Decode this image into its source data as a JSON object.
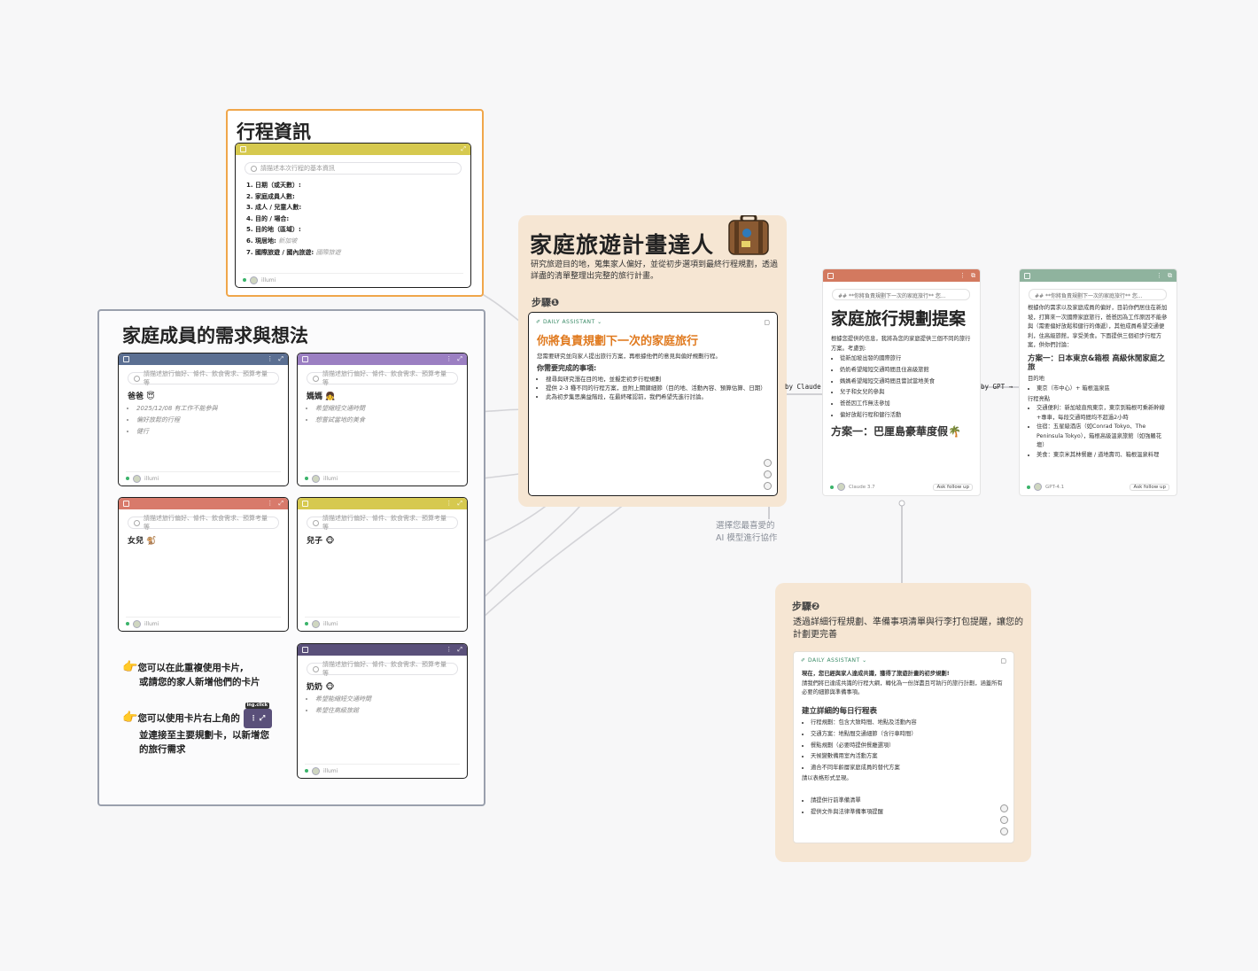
{
  "trip_info": {
    "title": "行程資訊",
    "prompt": "請描述本次行程的基本資訊",
    "items": [
      {
        "label": "1. 日期（或天數）:",
        "value": ""
      },
      {
        "label": "2. 家庭成員人數:",
        "value": ""
      },
      {
        "label": "3. 成人 / 兒童人數:",
        "value": ""
      },
      {
        "label": "4. 目的 / 場合:",
        "value": ""
      },
      {
        "label": "5. 目的地（區域）:",
        "value": ""
      },
      {
        "label": "6. 現居地:",
        "value": "新加坡"
      },
      {
        "label": "7. 國際旅遊 / 國內旅遊:",
        "value": "國際旅遊"
      }
    ],
    "footer_user": "illumi",
    "header_color": "#d6c94f"
  },
  "family": {
    "title": "家庭成員的需求與想法",
    "prompt": "請描述旅行偏好、條件、飲食需求、預算考量等",
    "footer_user": "illumi",
    "members": [
      {
        "name": "爸爸 😇",
        "color": "#5b6f92",
        "bullets": [
          "2025/12/08 有工作不能參與",
          "偏好放鬆的行程",
          "健行"
        ]
      },
      {
        "name": "媽媽 👧",
        "color": "#9b7fc2",
        "bullets": [
          "希望縮短交通時間",
          "想嘗試當地的美食"
        ]
      },
      {
        "name": "女兒 🐒",
        "color": "#d87a6b",
        "bullets": []
      },
      {
        "name": "兒子 🐵",
        "color": "#d6c94f",
        "bullets": []
      },
      {
        "name": "奶奶 🐵",
        "color": "#5a507a",
        "bullets": [
          "希望能縮短交通時間",
          "希望住高級旅館"
        ]
      }
    ]
  },
  "hints": {
    "line1a": "您可以在此重複使用卡片,",
    "line1b": "或請您的家人新增他們的卡片",
    "line2a": "您可以使用卡片右上角的",
    "line2b": "並連接至主要規劃卡，以新增您",
    "line2c": "的旅行需求",
    "hint_badge": "ing.click"
  },
  "planner": {
    "title": "家庭旅遊計畫達人",
    "subtitle": "研究旅遊目的地，蒐集家人偏好，並從初步選項到最終行程規劃，透過詳盡的清單整理出完整的旅行計畫。",
    "step1_label": "步驟❶",
    "assistant_label": "DAILY ASSISTANT",
    "card_title": "你將負責規劃下一次的家庭旅行",
    "card_intro": "您需要研究並向家人提出旅行方案，再根據他們的意見與偏好規劃行程。",
    "todo_heading": "你需要完成的事項:",
    "todos": [
      "搜尋與研究潛在目的地，並擬定初步行程規劃",
      "提供 2-3 種不同的行程方案，並附上關鍵細節（目的地、活動內容、預算估算、日期）",
      "此為初步集思廣益階段，在最終確認前，我們希望先進行討論。"
    ],
    "caption": "選擇您最喜愛的\nAI 模型進行協作"
  },
  "claude_card": {
    "chip": "## **你將負責規劃下一次的家庭旅行** 您...",
    "title": "家庭旅行規劃提案",
    "intro": "根據您提供的信息，我將為您的家庭提供三個不同的旅行方案。考慮到:",
    "points": [
      "從新加坡出發的國際旅行",
      "奶奶希望縮短交通時間且住高級旅館",
      "媽媽希望縮短交通時間且嘗試當地美食",
      "兒子和女兒的參與",
      "爸爸因工作無法參加",
      "偏好放鬆行程和健行活動"
    ],
    "plan_title": "方案一：巴厘島豪華度假🌴",
    "model": "Claude 3.7",
    "ask": "Ask follow up",
    "header_color": "#d3795f"
  },
  "gpt_card": {
    "chip": "## **你將負責規劃下一次的家庭旅行** 您...",
    "intro": "根據你的需求以及家庭成員的偏好，目前你們居住在新加坡，打算來一次國際家庭旅行，爸爸因為工作原因不能參與（需要偏好放鬆和健行的傳遞），其他成員希望交通便利，住高級旅館，享受美食。下面提供三個初步行程方案，供你們討論：",
    "plan_title": "方案一：日本東京&箱根 高級休閒家庭之旅",
    "dest_label": "目的地",
    "dest": "東京（市中心）+ 箱根溫泉區",
    "highlights_label": "行程亮點",
    "highlights": [
      "交通便利：新加坡直飛東京，東京到箱根可乘新幹線+專車，每段交通時間均不超過2小時",
      "住宿：五星級酒店（如Conrad Tokyo、The Peninsula Tokyo），箱根高級溫泉旅館（如強羅花壇）",
      "美食：東京米其林餐廳 / 道地壽司、箱根溫泉料理"
    ],
    "model": "GPT-4.1",
    "ask": "Ask follow up",
    "header_color": "#8fb39e"
  },
  "by_claude": "by Claude",
  "by_gpt": "by GPT",
  "step2": {
    "label": "步驟❷",
    "desc": "透過詳細行程規劃、準備事項清單與行李打包提醒，讓您的計劃更完善",
    "assistant_label": "DAILY ASSISTANT",
    "intro": "現在，您已經與家人達成共識，獲得了旅遊計畫的初步規劃!",
    "intro2": "請我們將已達成共識的行程大綱，轉化為一份詳盡且可執行的旅行計劃，涵蓋所有必要的細節與準備事項。",
    "heading": "建立詳細的每日行程表",
    "items": [
      "行程規劃：包含大致時間、地點及活動內容",
      "交通方案：地點間交通細節（含行車時間）",
      "餐點規劃（必要時提供餐廳選項）",
      "天候變數備用室內活動方案",
      "適合不同年齡層家庭成員的替代方案"
    ],
    "table_note": "請以表格形式呈現。",
    "items2": [
      "請提供行前準備清單",
      "提供文件與法律準備事項提醒"
    ]
  }
}
